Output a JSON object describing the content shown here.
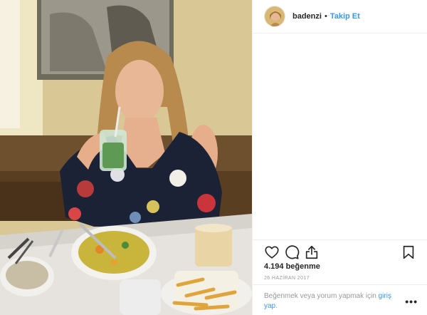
{
  "header": {
    "username": "badenzi",
    "separator": "•",
    "follow_label": "Takip Et"
  },
  "post": {
    "likes_text": "4.194 beğenme",
    "date_text": "26 HAZİRAN 2017"
  },
  "login_prompt": {
    "prefix": "Beğenmek veya yorum yapmak için ",
    "link": "giriş yap",
    "suffix": "."
  },
  "more_label": "•••",
  "icons": {
    "like": "heart-icon",
    "comment": "comment-icon",
    "share": "share-icon",
    "save": "bookmark-icon"
  },
  "colors": {
    "accent": "#3897f0",
    "text": "#262626",
    "muted": "#999999",
    "border": "#efefef"
  }
}
